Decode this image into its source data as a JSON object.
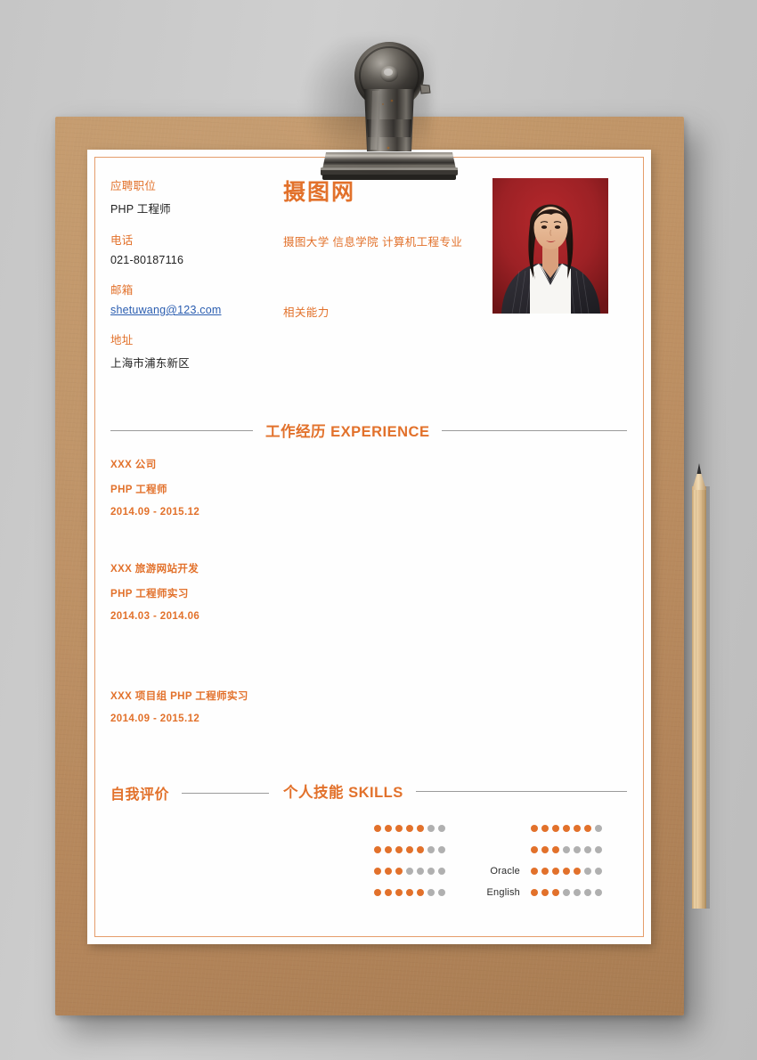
{
  "document": {
    "type": "resume-template",
    "accent_color": "#e2712b",
    "board_color": "#b98b5e",
    "background_color": "#c9c9c9",
    "paper_color": "#fefefe"
  },
  "header": {
    "name": "摄图网",
    "school_line": "摄图大学  信息学院  计算机工程专业",
    "ability_label": "相关能力"
  },
  "contact": {
    "fields": [
      {
        "label": "应聘职位",
        "value": "PHP 工程师",
        "kind": "text"
      },
      {
        "label": "电话",
        "value": "021-80187116",
        "kind": "text"
      },
      {
        "label": "邮箱",
        "value": "shetuwang@123.com",
        "kind": "link"
      },
      {
        "label": "地址",
        "value": "上海市浦东新区",
        "kind": "text"
      }
    ]
  },
  "sections": {
    "experience_title": "工作经历 EXPERIENCE",
    "self_eval_title": "自我评价",
    "skills_title": "个人技能  SKILLS"
  },
  "experience": [
    {
      "lines": [
        "XXX 公司",
        "PHP 工程师",
        "2014.09 - 2015.12"
      ]
    },
    {
      "lines": [
        "XXX 旅游网站开发",
        "PHP 工程师实习",
        "2014.03 - 2014.06"
      ]
    },
    {
      "lines": [
        "XXX 项目组 PHP 工程师实习",
        "2014.09 - 2015.12"
      ]
    }
  ],
  "skills": {
    "max_dots": 7,
    "left_column": [
      {
        "label": "",
        "filled": 5
      },
      {
        "label": "",
        "filled": 5
      },
      {
        "label": "",
        "filled": 3
      },
      {
        "label": "",
        "filled": 5
      }
    ],
    "right_column": [
      {
        "label": "",
        "filled": 6
      },
      {
        "label": "",
        "filled": 3
      },
      {
        "label": "Oracle",
        "filled": 5
      },
      {
        "label": "English",
        "filled": 3
      }
    ]
  },
  "decor": {
    "clip": "binder-clip",
    "pencil": "wooden-pencil",
    "photo": "portrait-photo"
  }
}
